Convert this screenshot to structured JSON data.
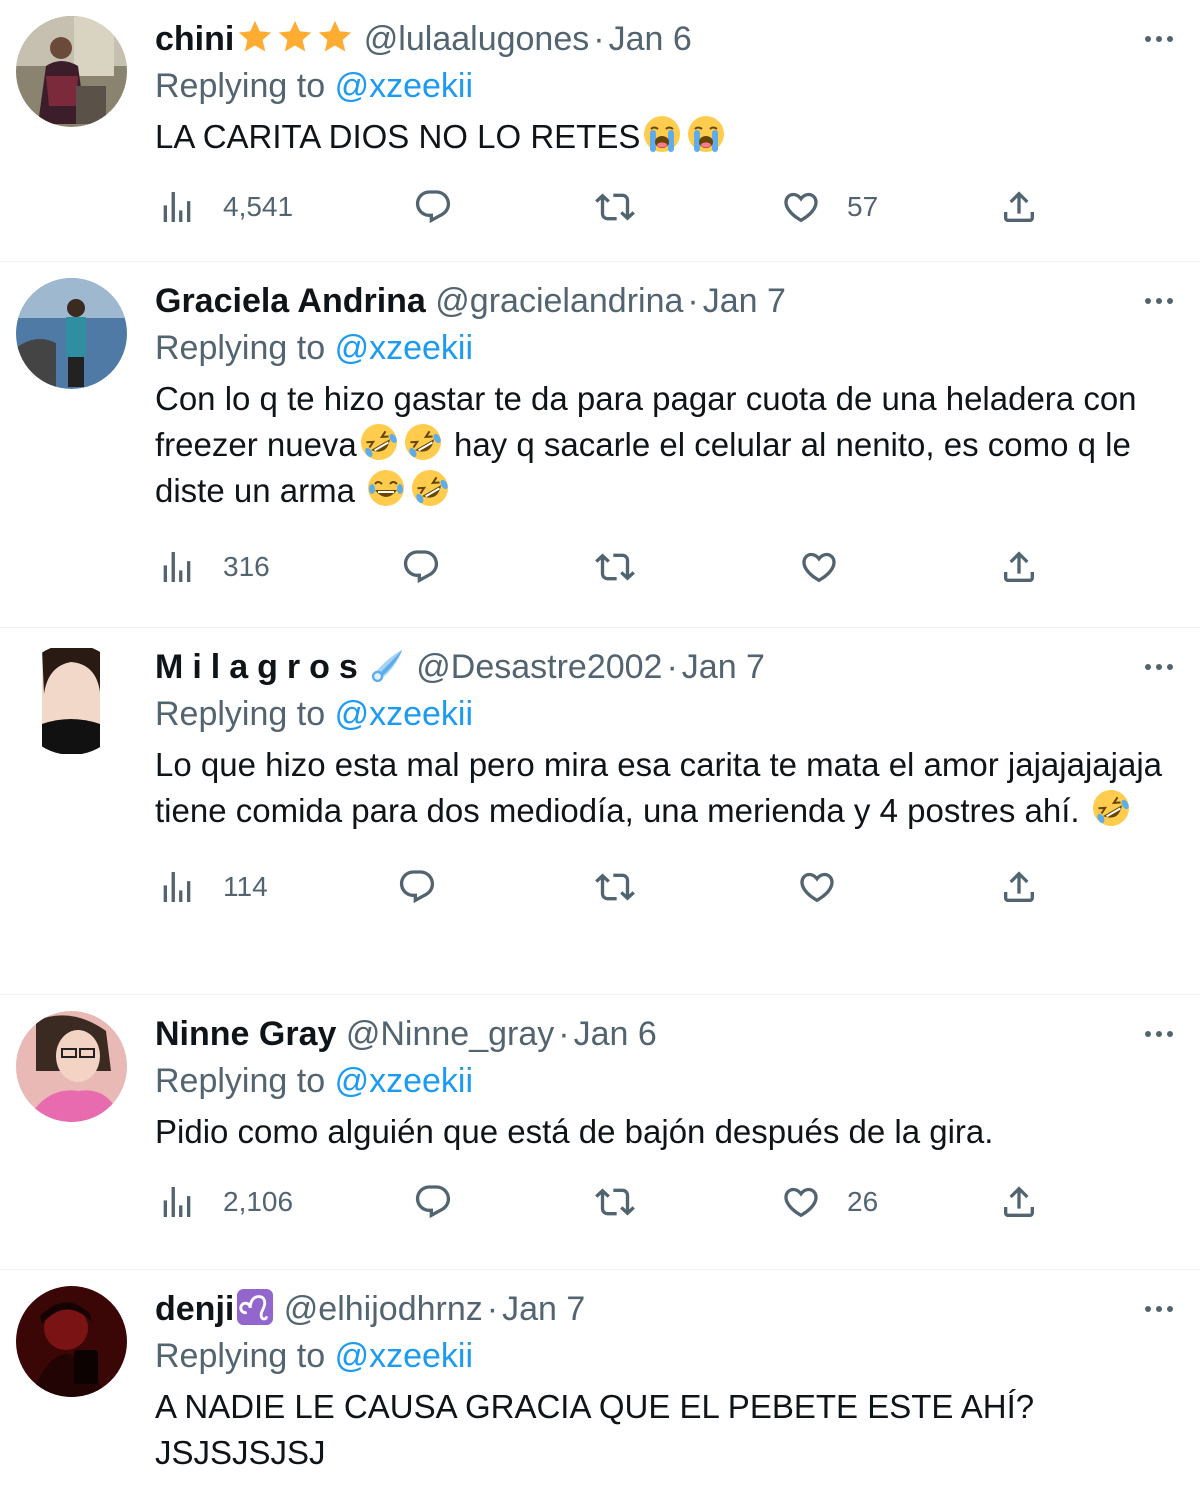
{
  "accent_color": "#1d9bf0",
  "secondary_text_color": "#536471",
  "replies": [
    {
      "name": "chini",
      "name_badge": "three-star-emoji",
      "handle": "@lulaalugones",
      "date": "Jan 6",
      "replying_prefix": "Replying to",
      "replying_to": "@xzeekii",
      "text_parts": [
        "LA CARITA DIOS NO LO RETES"
      ],
      "views": "4,541",
      "replies_count": "",
      "retweets": "",
      "likes": "57"
    },
    {
      "name": "Graciela Andrina",
      "handle": "@gracielandrina",
      "date": "Jan 7",
      "replying_prefix": "Replying to",
      "replying_to": "@xzeekii",
      "text_parts": [
        "Con lo q te hizo gastar te da para pagar cuota de una heladera con freezer nueva",
        " hay q sacarle el celular al nenito, es como q le diste un arma "
      ],
      "views": "316",
      "likes": ""
    },
    {
      "name": "Milagros",
      "name_badge": "comet-emoji",
      "handle": "@Desastre2002",
      "date": "Jan 7",
      "replying_prefix": "Replying to",
      "replying_to": "@xzeekii",
      "text_parts": [
        "Lo que hizo esta mal pero mira esa carita te mata el amor jajajajajaja tiene comida para dos mediodía, una merienda y 4 postres ahí. "
      ],
      "views": "114",
      "likes": ""
    },
    {
      "name": "Ninne Gray",
      "handle": "@Ninne_gray",
      "date": "Jan 6",
      "replying_prefix": "Replying to",
      "replying_to": "@xzeekii",
      "text_parts": [
        "Pidio como alguién que está de bajón después de la gira."
      ],
      "views": "2,106",
      "likes": "26"
    },
    {
      "name": "denji",
      "name_badge": "leo-sign-emoji",
      "handle": "@elhijodhrnz",
      "date": "Jan 7",
      "replying_prefix": "Replying to",
      "replying_to": "@xzeekii",
      "text_parts": [
        "A NADIE LE CAUSA GRACIA QUE EL PEBETE ESTE AHÍ? JSJSJSJSJ"
      ]
    }
  ],
  "icons": {
    "more": "more-dots-icon",
    "views": "views-bar-chart-icon",
    "reply": "reply-bubble-icon",
    "retweet": "retweet-icon",
    "like": "heart-icon",
    "share": "share-upload-icon",
    "emoji_crying": "loudly-crying-face-emoji",
    "emoji_rofl": "rolling-on-floor-laughing-emoji",
    "emoji_joy": "tears-of-joy-emoji"
  }
}
